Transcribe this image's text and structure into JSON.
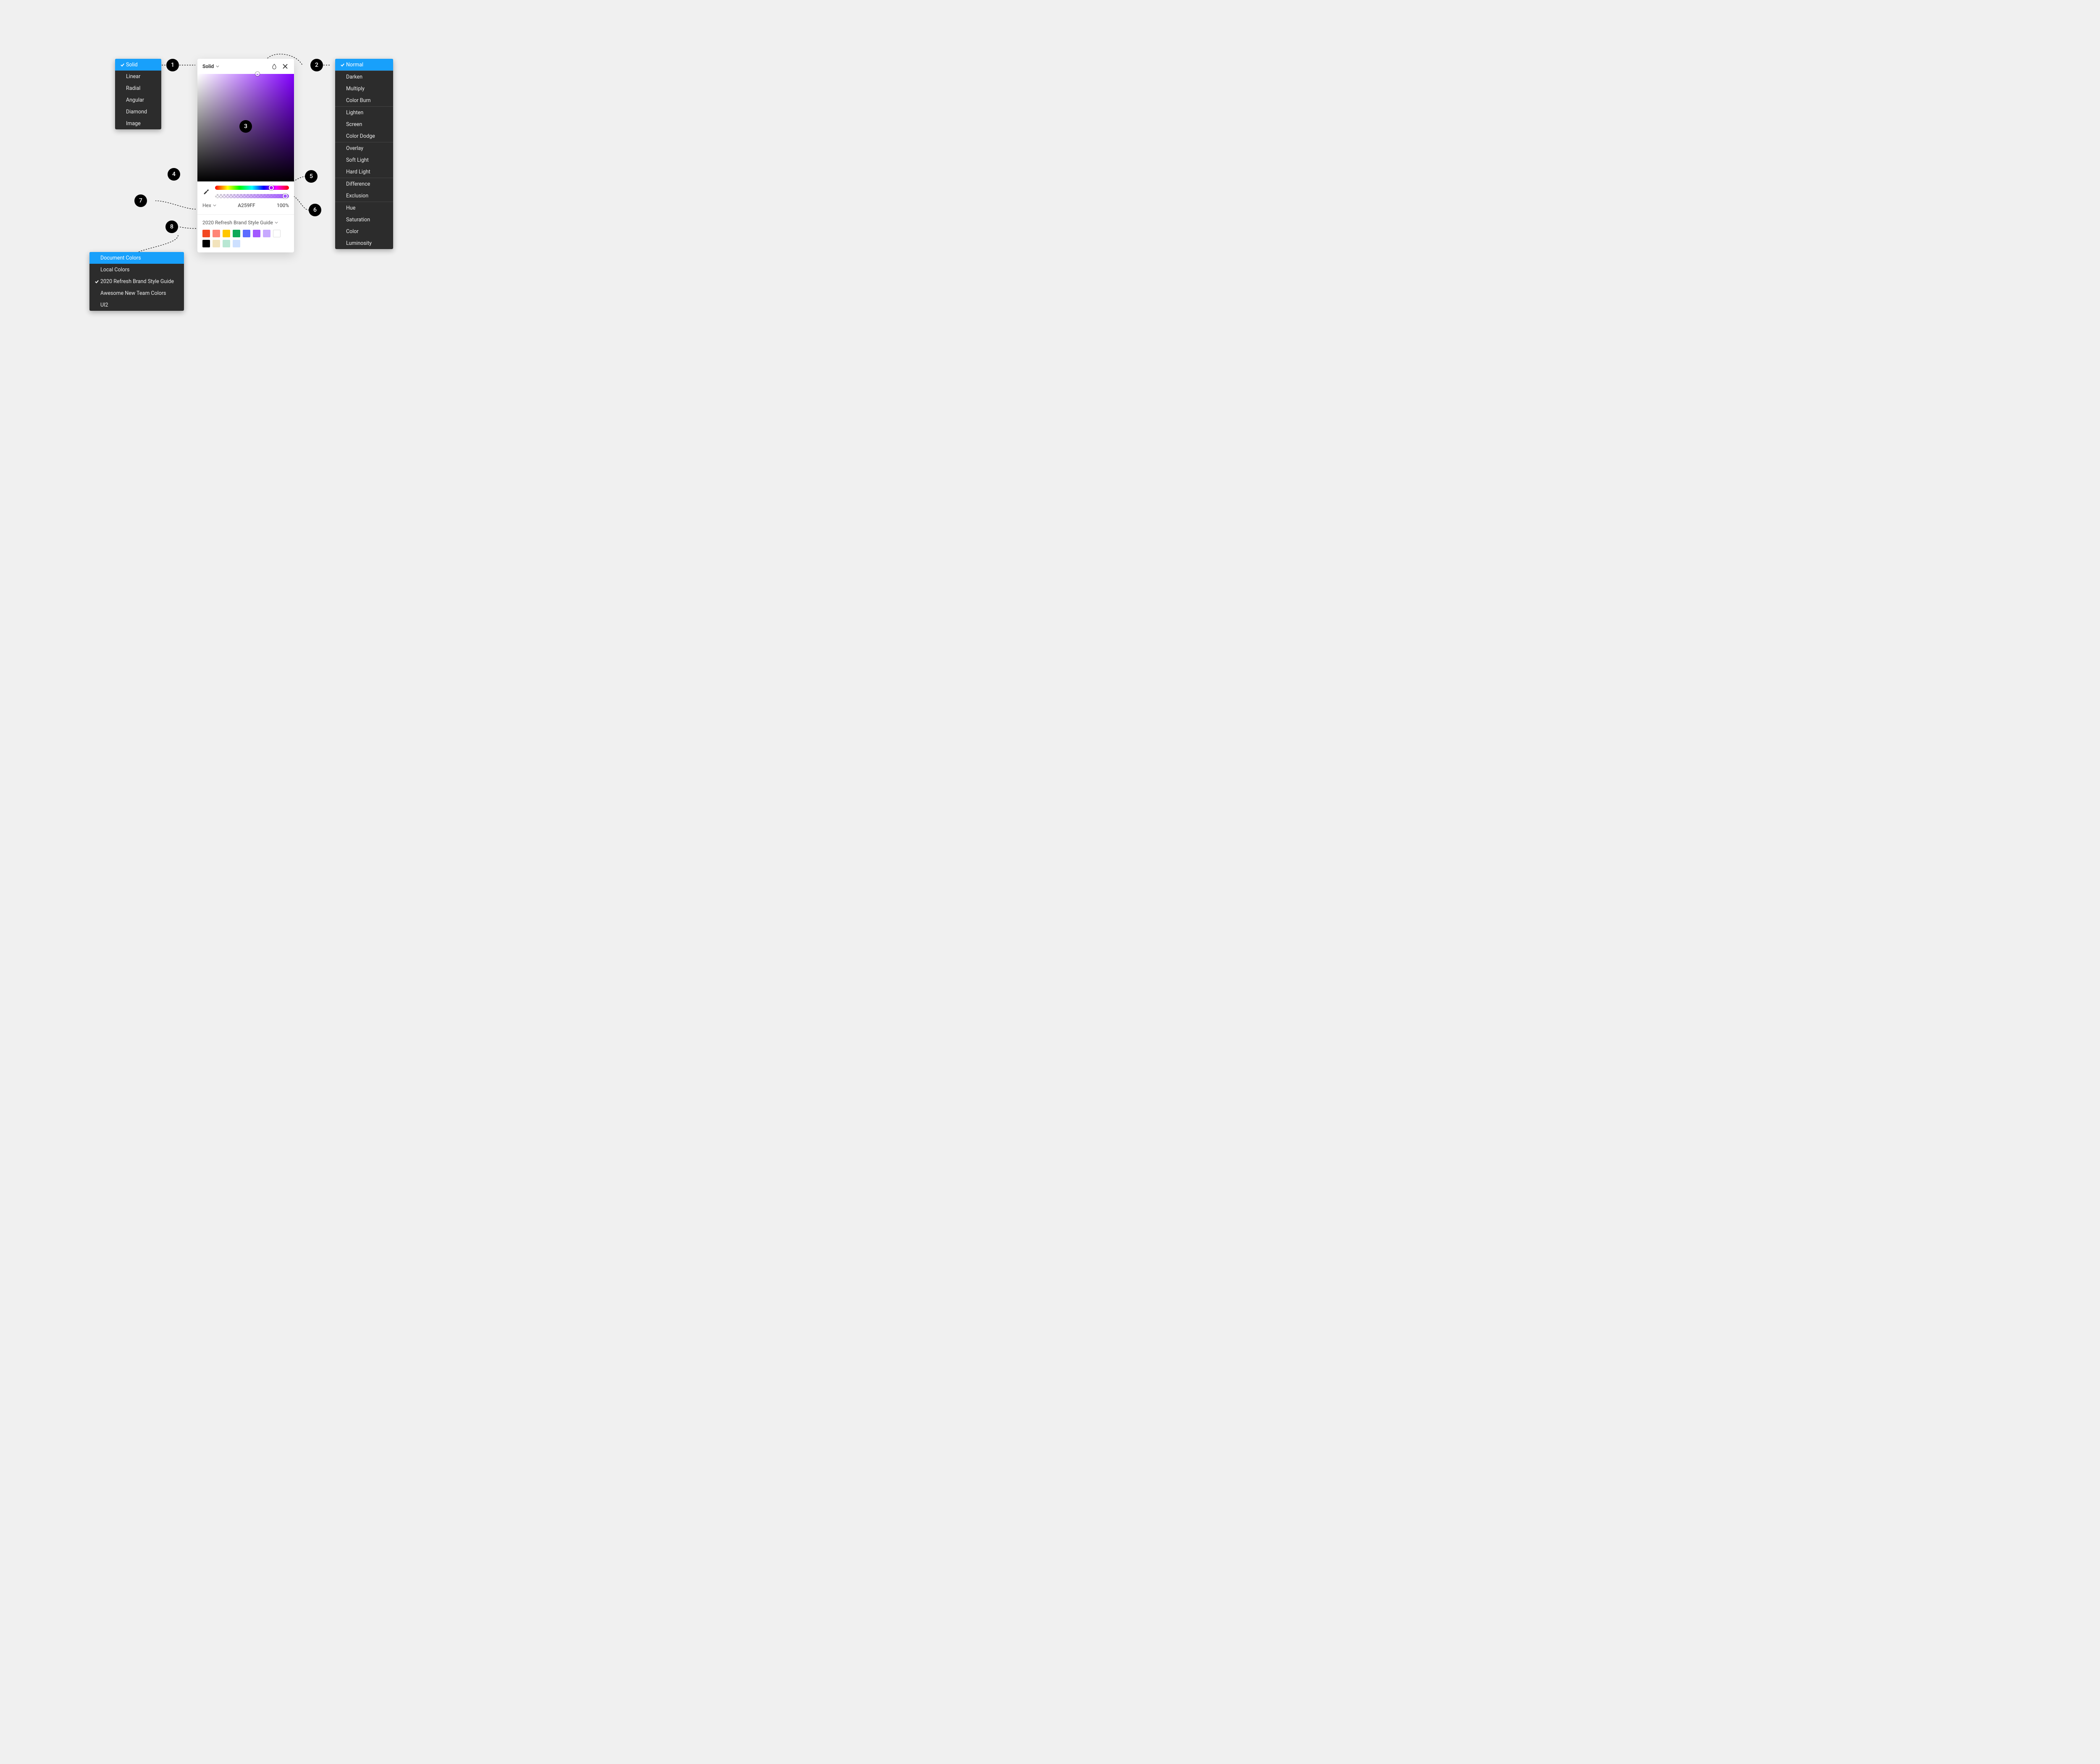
{
  "paint_type_menu": {
    "items": [
      "Solid",
      "Linear",
      "Radial",
      "Angular",
      "Diamond",
      "Image"
    ],
    "selected": "Solid"
  },
  "blend_menu": {
    "groups": [
      [
        "Normal"
      ],
      [
        "Darken",
        "Multiply",
        "Color Burn"
      ],
      [
        "Lighten",
        "Screen",
        "Color Dodge"
      ],
      [
        "Overlay",
        "Soft Light",
        "Hard Light"
      ],
      [
        "Difference",
        "Exclusion"
      ],
      [
        "Hue",
        "Saturation",
        "Color",
        "Luminosity"
      ]
    ],
    "selected": "Normal"
  },
  "library_menu": {
    "items": [
      "Document Colors",
      "Local Colors",
      "2020 Refresh Brand Style Guide",
      "Awesome New Team Colors",
      "UI2"
    ],
    "highlighted": "Document Colors",
    "checked": "2020 Refresh Brand Style Guide"
  },
  "panel": {
    "type_label": "Solid",
    "color_mode": "Hex",
    "hex": "A259FF",
    "opacity": "100%",
    "library_label": "2020 Refresh Brand Style Guide",
    "swatches": [
      "#F24822",
      "#FF8577",
      "#FFC700",
      "#0FA958",
      "#5C6CFF",
      "#A259FF",
      "#C7A9FF",
      "#FFFFFF",
      "#000000",
      "#F2E3BC",
      "#B8E7D3",
      "#CDE0FF"
    ]
  },
  "callouts": [
    "1",
    "2",
    "3",
    "4",
    "5",
    "6",
    "7",
    "8"
  ]
}
